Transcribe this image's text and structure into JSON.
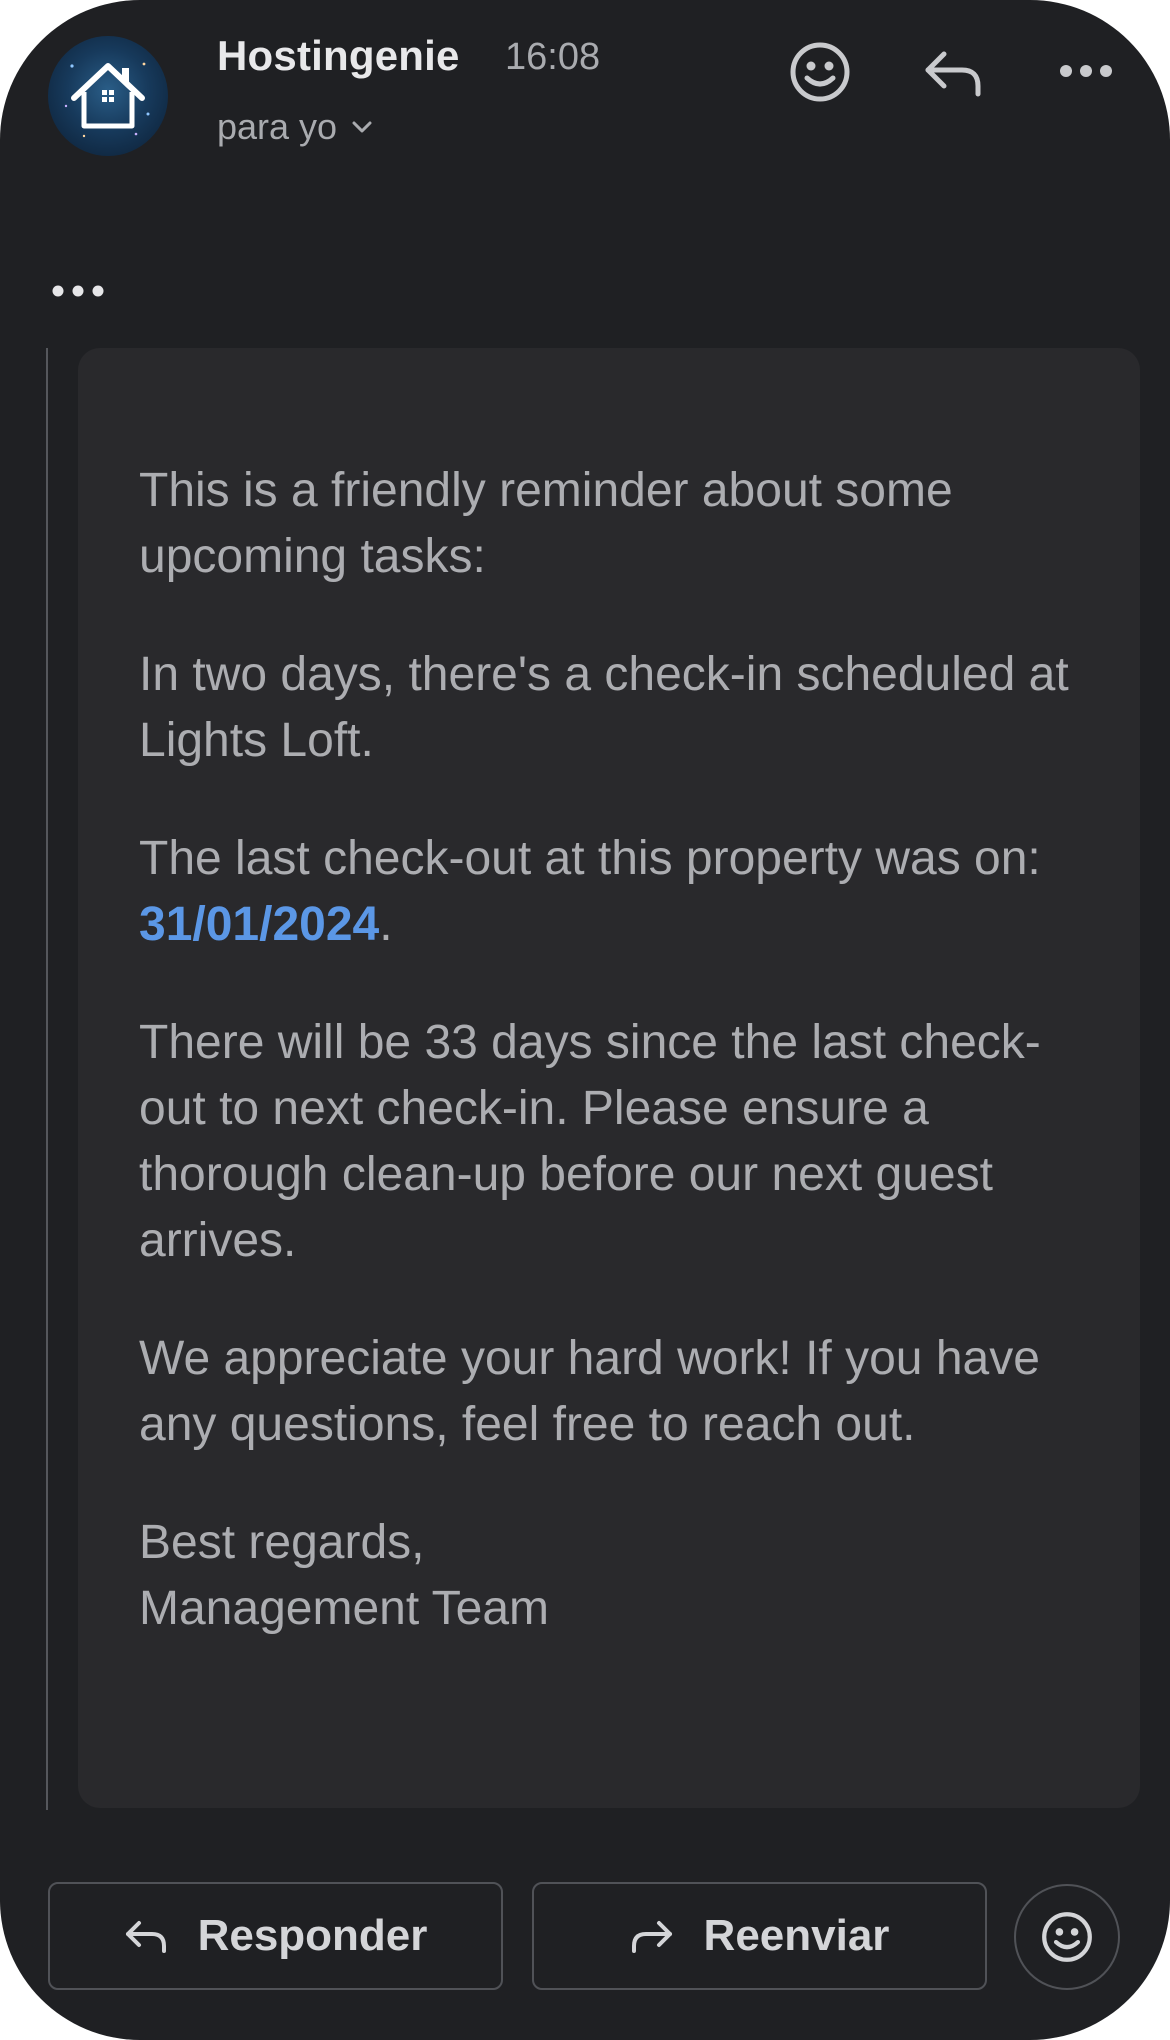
{
  "header": {
    "sender": "Hostingenie",
    "time": "16:08",
    "recipient": "para yo",
    "avatar_icon": "house-icon",
    "actions": [
      "emoji-reaction-icon",
      "reply-icon",
      "more-options-icon"
    ]
  },
  "email": {
    "paragraphs": [
      "This is a friendly reminder about some upcoming tasks:",
      "In two days, there's a check-in scheduled at Lights Loft.",
      "There will be 33 days since the last check-out to next check-in. Please ensure a thorough clean-up before our next guest arrives.",
      "We appreciate your hard work! If you have any questions, feel free to reach out."
    ],
    "checkout_prefix": "The last check-out at this property was on: ",
    "checkout_date": "31/01/2024",
    "checkout_suffix": ".",
    "signoff": "Best regards,",
    "signature": "Management Team"
  },
  "footer": {
    "reply_label": "Responder",
    "forward_label": "Reenviar"
  },
  "colors": {
    "background": "#1f2023",
    "card": "#29292c",
    "body_text": "#acadb1",
    "link": "#5b97e6"
  }
}
